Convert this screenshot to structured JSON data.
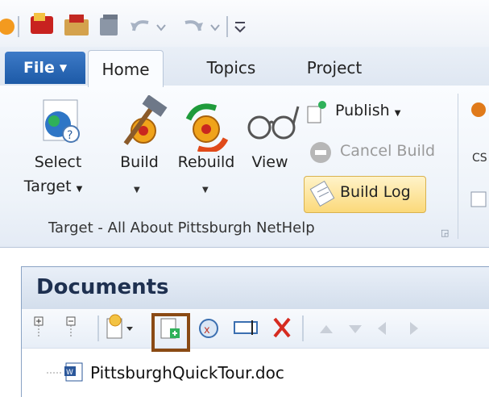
{
  "file_tab": "File",
  "tabs": [
    "Home",
    "Topics",
    "Project"
  ],
  "ribbon": {
    "select_target": [
      "Select",
      "Target"
    ],
    "build": "Build",
    "rebuild": "Rebuild",
    "view": "View",
    "publish": "Publish",
    "cancel_build": "Cancel Build",
    "build_log": "Build Log",
    "group_label": "Target - All About Pittsburgh NetHelp"
  },
  "documents": {
    "title": "Documents",
    "items": [
      "PittsburghQuickTour.doc"
    ]
  }
}
